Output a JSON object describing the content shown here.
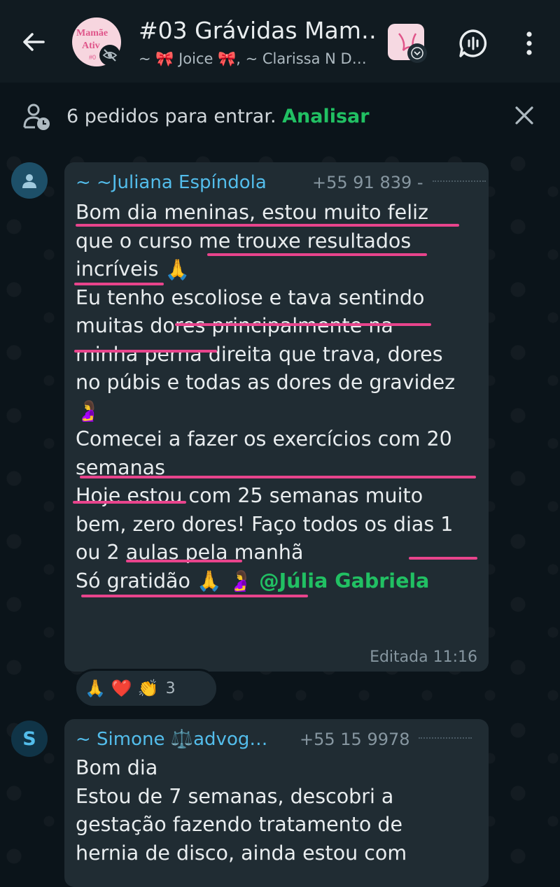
{
  "header": {
    "group_avatar_line1": "Mamãe",
    "group_avatar_line2": "Ativ",
    "group_avatar_line3": "#0",
    "title": "#03 Grávidas Mam…",
    "subtitle": "~ 🎀 Joice 🎀, ~ Clarissa N D…"
  },
  "banner": {
    "text": "6 pedidos para entrar. ",
    "action": "Analisar"
  },
  "messages": [
    {
      "sender": "~ ~Juliana Espíndola",
      "phone": "+55 91 839  -",
      "lines": [
        "Bom dia meninas, estou muito feliz",
        "que o curso me trouxe resultados",
        "incríveis",
        "Eu tenho escoliose e tava sentindo",
        "muitas dores principalmente na",
        "minha perna direita que trava, dores",
        "no púbis e todas as dores de gravidez",
        "",
        "Comecei a fazer os exercícios com 20",
        "semanas",
        "Hoje estou com 25 semanas muito",
        "bem, zero dores! Faço todos os dias 1",
        "ou 2 aulas pela manhã",
        "Só gratidão"
      ],
      "mention": "@Júlia Gabriela",
      "timestamp": "Editada 11:16",
      "reactions": {
        "emojis": [
          "🙏",
          "❤️",
          "👏"
        ],
        "count": "3"
      }
    },
    {
      "avatar_letter": "S",
      "sender": "~ Simone ⚖️advog…",
      "phone": "+55 15 9978",
      "lines": [
        "Bom dia",
        "Estou de 7 semanas, descobri a",
        "gestação fazendo tratamento de",
        "hernia de disco, ainda estou com"
      ]
    }
  ],
  "colors": {
    "background": "#0b141a",
    "bubble": "#202c33",
    "sender_name": "#53bdeb",
    "accent_green": "#21c063",
    "underline_annotation": "#e8448c"
  }
}
